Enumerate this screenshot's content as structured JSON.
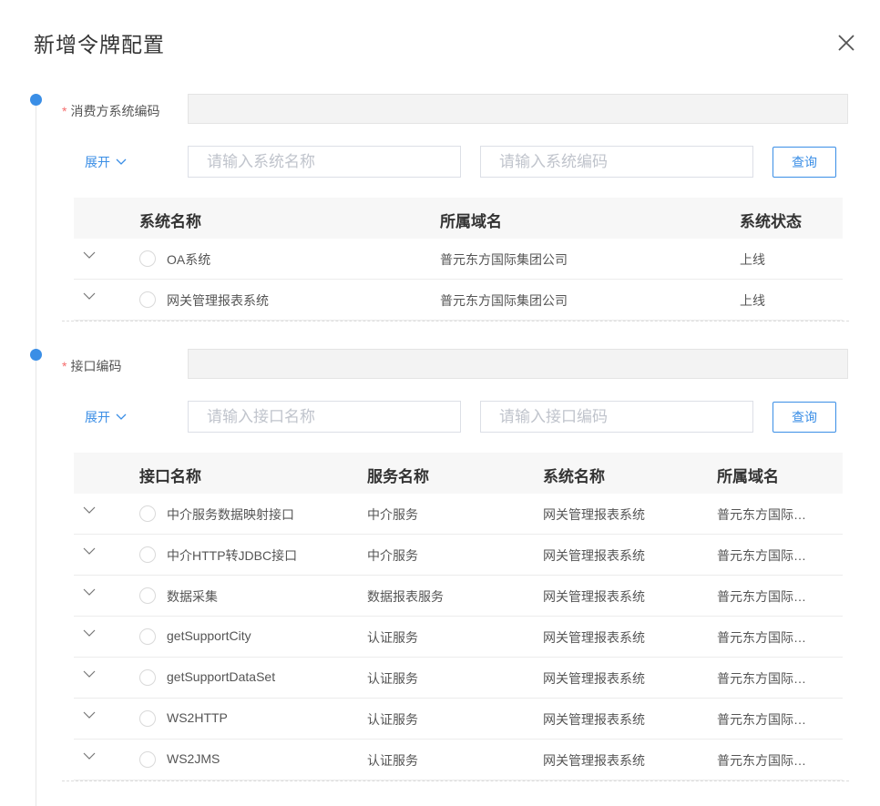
{
  "dialog": {
    "title": "新增令牌配置"
  },
  "section1": {
    "label": "消费方系统编码",
    "required_mark": "*",
    "expand_label": "展开",
    "search_name_placeholder": "请输入系统名称",
    "search_code_placeholder": "请输入系统编码",
    "query_label": "查询",
    "columns": [
      "系统名称",
      "所属域名",
      "系统状态"
    ],
    "rows": [
      {
        "name": "OA系统",
        "domain": "普元东方国际集团公司",
        "status": "上线"
      },
      {
        "name": "网关管理报表系统",
        "domain": "普元东方国际集团公司",
        "status": "上线"
      }
    ]
  },
  "section2": {
    "label": "接口编码",
    "required_mark": "*",
    "expand_label": "展开",
    "search_name_placeholder": "请输入接口名称",
    "search_code_placeholder": "请输入接口编码",
    "query_label": "查询",
    "columns": [
      "接口名称",
      "服务名称",
      "系统名称",
      "所属域名"
    ],
    "rows": [
      {
        "name": "中介服务数据映射接口",
        "service": "中介服务",
        "system": "网关管理报表系统",
        "domain": "普元东方国际集团公司"
      },
      {
        "name": "中介HTTP转JDBC接口",
        "service": "中介服务",
        "system": "网关管理报表系统",
        "domain": "普元东方国际集团公司"
      },
      {
        "name": "数据采集",
        "service": "数据报表服务",
        "system": "网关管理报表系统",
        "domain": "普元东方国际集团公司"
      },
      {
        "name": "getSupportCity",
        "service": "认证服务",
        "system": "网关管理报表系统",
        "domain": "普元东方国际集团公司"
      },
      {
        "name": "getSupportDataSet",
        "service": "认证服务",
        "system": "网关管理报表系统",
        "domain": "普元东方国际集团公司"
      },
      {
        "name": "WS2HTTP",
        "service": "认证服务",
        "system": "网关管理报表系统",
        "domain": "普元东方国际集团公司"
      },
      {
        "name": "WS2JMS",
        "service": "认证服务",
        "system": "网关管理报表系统",
        "domain": "普元东方国际集团公司"
      }
    ]
  },
  "icons": {
    "close": "close-icon",
    "expand": "chevron-down-icon",
    "row_expand": "chevron-down-icon"
  },
  "colors": {
    "accent": "#3a8ee6",
    "required": "#f56c6c"
  }
}
